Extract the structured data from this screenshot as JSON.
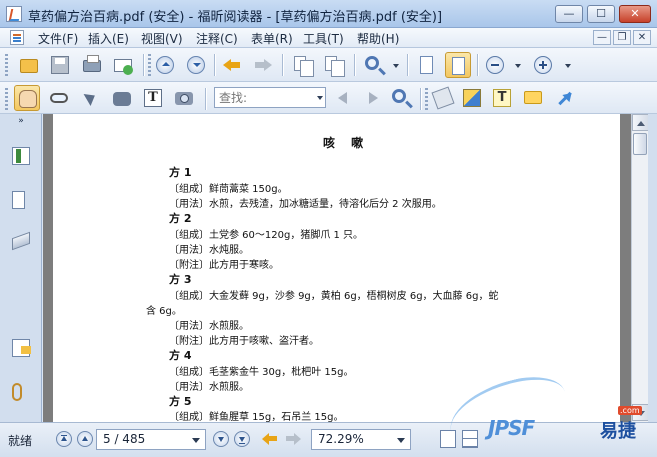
{
  "window": {
    "title": "草药偏方治百病.pdf (安全) - 福昕阅读器 - [草药偏方治百病.pdf (安全)]",
    "minimize_glyph": "—",
    "maximize_glyph": "☐",
    "close_glyph": "✕"
  },
  "menubar": {
    "items": [
      "文件(F)",
      "插入(E)",
      "视图(V)",
      "注释(C)",
      "表单(R)",
      "工具(T)",
      "帮助(H)"
    ],
    "mdi_minimize": "—",
    "mdi_restore": "❐",
    "mdi_close": "✕"
  },
  "toolbar": {
    "search_placeholder": "查找:"
  },
  "sidebar": {
    "collapse_glyph": "»"
  },
  "document": {
    "title": "咳 嗽",
    "lines": [
      "方 1",
      "〔组成〕鲜茼蒿菜 150g。",
      "〔用法〕水煎，去残渣，加冰糖适量，待溶化后分 2 次服用。",
      "方 2",
      "〔组成〕土党参 60～120g，猪脚爪 1 只。",
      "〔用法〕水炖服。",
      "〔附注〕此方用于寒咳。",
      "方 3",
      "〔组成〕大金发藓 9g，沙参 9g，黄柏 6g，梧桐树皮 6g，大血藤 6g，蛇",
      "含 6g。",
      "〔用法〕水煎服。",
      "〔附注〕此方用于咳嗽、盗汗者。",
      "方 4",
      "〔组成〕毛茎紫金牛 30g，枇杷叶 15g。",
      "〔用法〕水煎服。",
      "方 5",
      "〔组成〕鲜鱼腥草 15g，石吊兰 15g。"
    ]
  },
  "statusbar": {
    "status": "就绪",
    "page": "5 / 485",
    "zoom": "72.29%"
  },
  "watermark": {
    "brand": "JPSF",
    "brand_cn": "易捷",
    "badge": ".com"
  },
  "colors": {
    "title_bar": "#bcd3ef",
    "document_background": "#7d7d7d",
    "page": "#ffffff",
    "active_tool": "#f3c760"
  }
}
